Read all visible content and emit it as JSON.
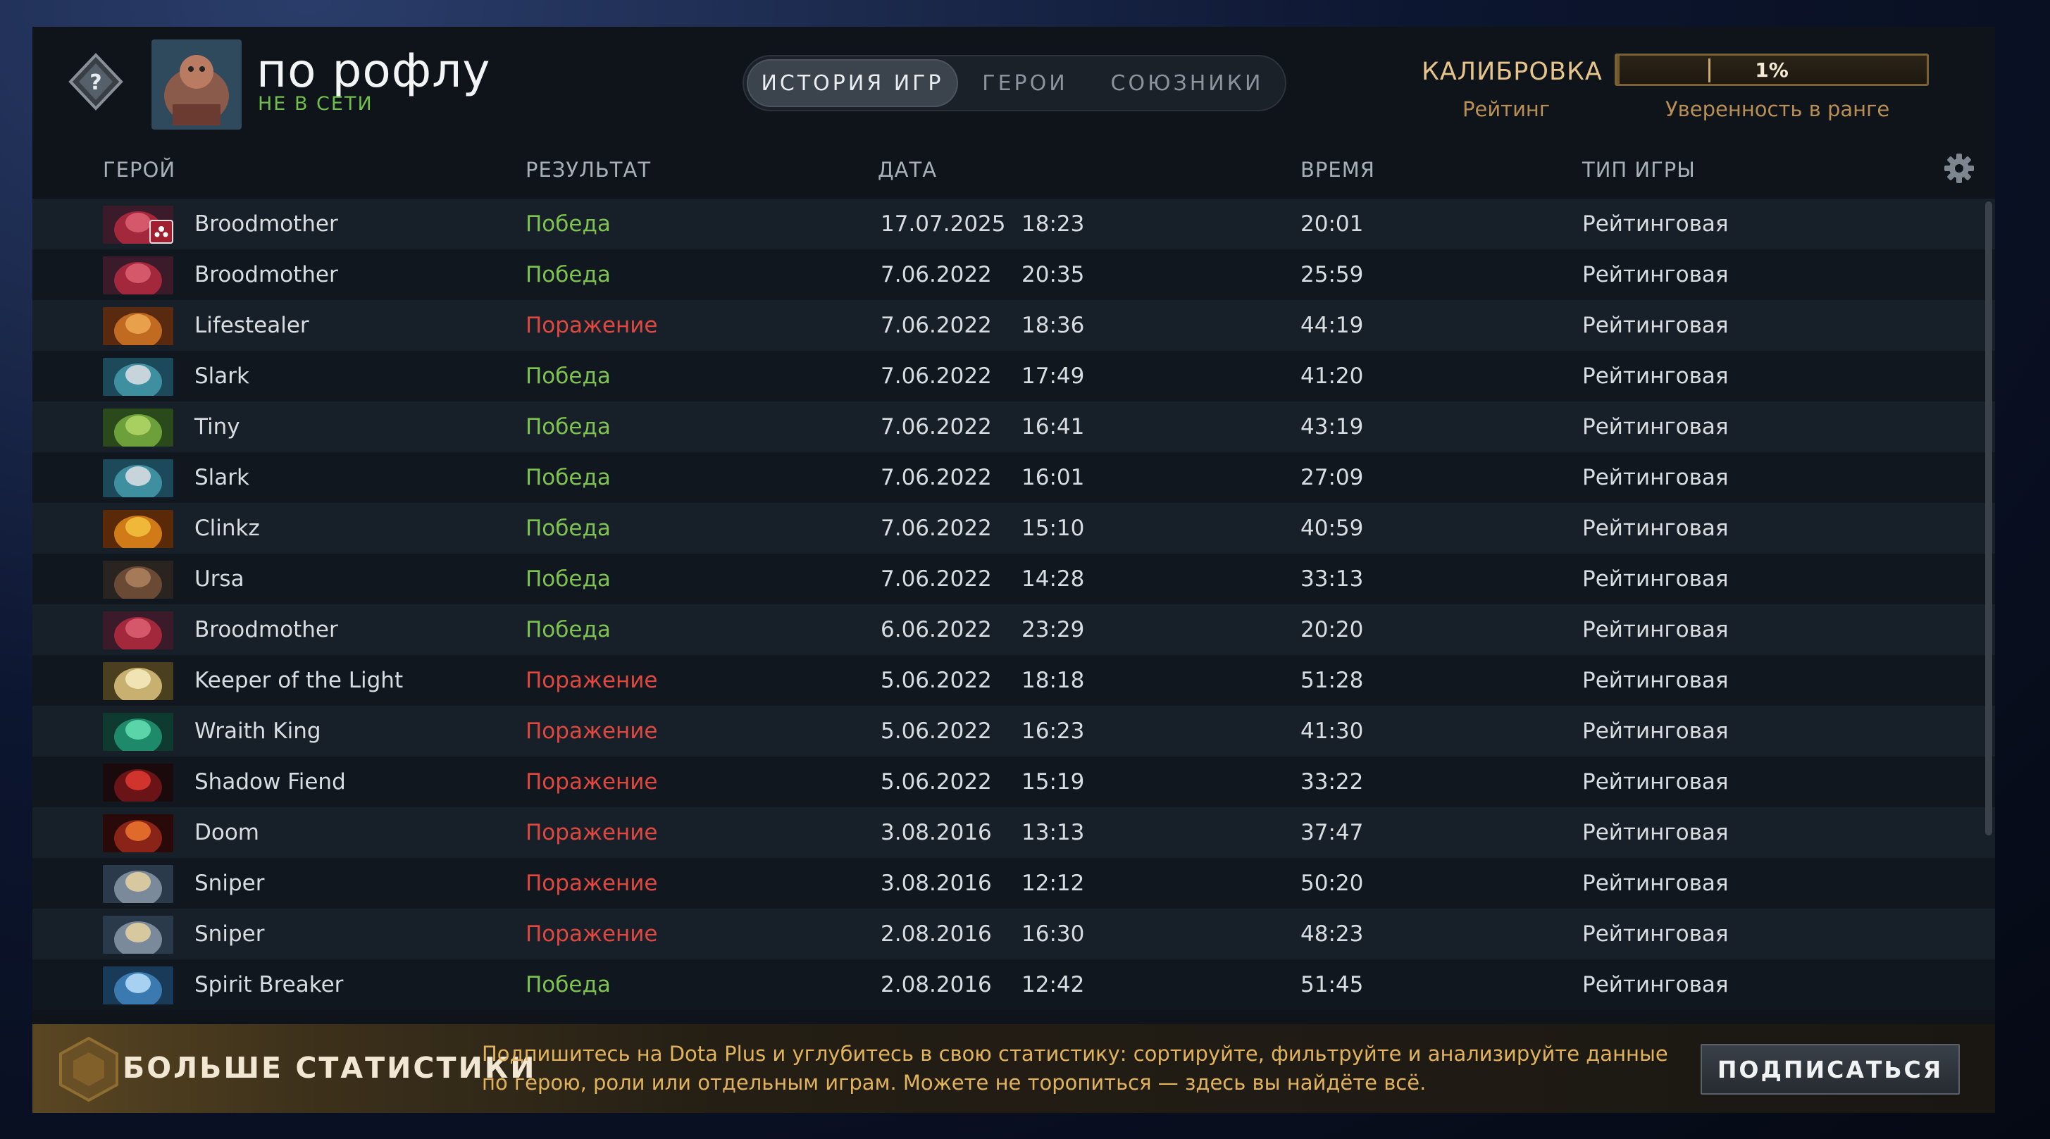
{
  "player": {
    "name": "по рофлу",
    "status": "НЕ В СЕТИ"
  },
  "tabs": [
    {
      "label": "ИСТОРИЯ ИГР",
      "active": true
    },
    {
      "label": "ГЕРОИ",
      "active": false
    },
    {
      "label": "СОЮЗНИКИ",
      "active": false
    }
  ],
  "calibration": {
    "title": "КАЛИБРОВКА",
    "rating_label": "Рейтинг",
    "confidence_value": "1%",
    "confidence_fraction": 0.01,
    "confidence_label": "Уверенность в ранге"
  },
  "table": {
    "headers": {
      "hero": "ГЕРОЙ",
      "result": "РЕЗУЛЬТАТ",
      "date": "ДАТА",
      "duration": "ВРЕМЯ",
      "type": "ТИП ИГРЫ"
    },
    "rows": [
      {
        "hero": "Broodmother",
        "result": "Победа",
        "win": true,
        "date": "17.07.2025",
        "time": "18:23",
        "duration": "20:01",
        "type": "Рейтинговая",
        "portrait": "broodmother"
      },
      {
        "hero": "Broodmother",
        "result": "Победа",
        "win": true,
        "date": "7.06.2022",
        "time": "20:35",
        "duration": "25:59",
        "type": "Рейтинговая",
        "portrait": "broodmother"
      },
      {
        "hero": "Lifestealer",
        "result": "Поражение",
        "win": false,
        "date": "7.06.2022",
        "time": "18:36",
        "duration": "44:19",
        "type": "Рейтинговая",
        "portrait": "lifestealer"
      },
      {
        "hero": "Slark",
        "result": "Победа",
        "win": true,
        "date": "7.06.2022",
        "time": "17:49",
        "duration": "41:20",
        "type": "Рейтинговая",
        "portrait": "slark"
      },
      {
        "hero": "Tiny",
        "result": "Победа",
        "win": true,
        "date": "7.06.2022",
        "time": "16:41",
        "duration": "43:19",
        "type": "Рейтинговая",
        "portrait": "tiny"
      },
      {
        "hero": "Slark",
        "result": "Победа",
        "win": true,
        "date": "7.06.2022",
        "time": "16:01",
        "duration": "27:09",
        "type": "Рейтинговая",
        "portrait": "slark"
      },
      {
        "hero": "Clinkz",
        "result": "Победа",
        "win": true,
        "date": "7.06.2022",
        "time": "15:10",
        "duration": "40:59",
        "type": "Рейтинговая",
        "portrait": "clinkz"
      },
      {
        "hero": "Ursa",
        "result": "Победа",
        "win": true,
        "date": "7.06.2022",
        "time": "14:28",
        "duration": "33:13",
        "type": "Рейтинговая",
        "portrait": "ursa"
      },
      {
        "hero": "Broodmother",
        "result": "Победа",
        "win": true,
        "date": "6.06.2022",
        "time": "23:29",
        "duration": "20:20",
        "type": "Рейтинговая",
        "portrait": "broodmother"
      },
      {
        "hero": "Keeper of the Light",
        "result": "Поражение",
        "win": false,
        "date": "5.06.2022",
        "time": "18:18",
        "duration": "51:28",
        "type": "Рейтинговая",
        "portrait": "keeper"
      },
      {
        "hero": "Wraith King",
        "result": "Поражение",
        "win": false,
        "date": "5.06.2022",
        "time": "16:23",
        "duration": "41:30",
        "type": "Рейтинговая",
        "portrait": "wraith"
      },
      {
        "hero": "Shadow Fiend",
        "result": "Поражение",
        "win": false,
        "date": "5.06.2022",
        "time": "15:19",
        "duration": "33:22",
        "type": "Рейтинговая",
        "portrait": "shadowfiend"
      },
      {
        "hero": "Doom",
        "result": "Поражение",
        "win": false,
        "date": "3.08.2016",
        "time": "13:13",
        "duration": "37:47",
        "type": "Рейтинговая",
        "portrait": "doom"
      },
      {
        "hero": "Sniper",
        "result": "Поражение",
        "win": false,
        "date": "3.08.2016",
        "time": "12:12",
        "duration": "50:20",
        "type": "Рейтинговая",
        "portrait": "sniper"
      },
      {
        "hero": "Sniper",
        "result": "Поражение",
        "win": false,
        "date": "2.08.2016",
        "time": "16:30",
        "duration": "48:23",
        "type": "Рейтинговая",
        "portrait": "sniper"
      },
      {
        "hero": "Spirit Breaker",
        "result": "Победа",
        "win": true,
        "date": "2.08.2016",
        "time": "12:42",
        "duration": "51:45",
        "type": "Рейтинговая",
        "portrait": "spiritbreaker"
      }
    ]
  },
  "promo": {
    "title": "БОЛЬШЕ СТАТИСТИКИ",
    "text_line1": "Подпишитесь на Dota Plus и углубитесь в свою статистику: сортируйте, фильтруйте и анализируйте данные",
    "text_line2": "по герою, роли или отдельным играм. Можете не торопиться — здесь вы найдёте всё.",
    "button": "ПОДПИСАТЬСЯ"
  },
  "colors": {
    "win": "#7ec34f",
    "loss": "#e0473e",
    "gold": "#e6c48a",
    "status_offline": "#6fbf48"
  },
  "icons": {
    "rank": "unknown-rank-icon",
    "settings": "gear-icon",
    "party": "party-match-icon",
    "promo": "dota-plus-icon"
  }
}
